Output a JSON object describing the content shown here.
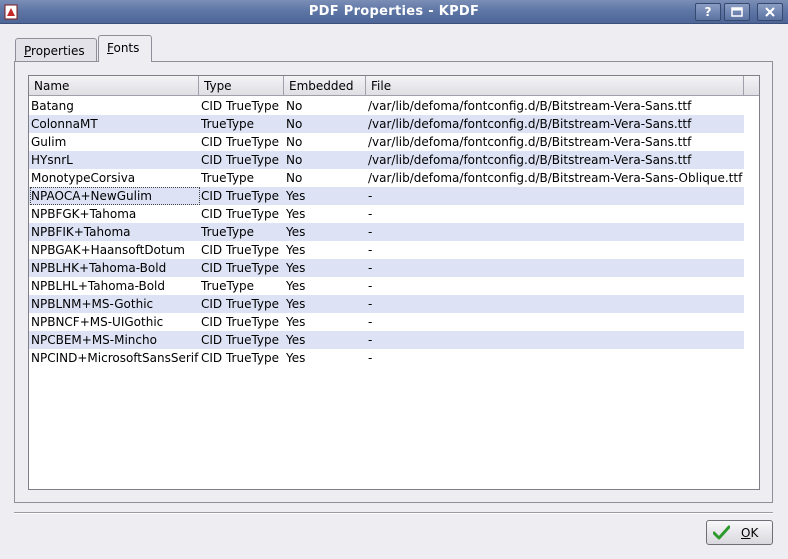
{
  "window": {
    "title": "PDF Properties - KPDF",
    "help_label": "?",
    "maximize_icon": "maximize-icon",
    "close_icon": "close-icon",
    "app_icon": "kpdf-app-icon"
  },
  "tabs": [
    {
      "mnemonic": "P",
      "rest": "roperties",
      "selected": false
    },
    {
      "mnemonic": "F",
      "rest": "onts",
      "selected": true
    }
  ],
  "fonts_table": {
    "headers": [
      "Name",
      "Type",
      "Embedded",
      "File"
    ],
    "rows": [
      {
        "name": "Batang",
        "type": "CID TrueType",
        "embedded": "No",
        "file": "/var/lib/defoma/fontconfig.d/B/Bitstream-Vera-Sans.ttf"
      },
      {
        "name": "ColonnaMT",
        "type": "TrueType",
        "embedded": "No",
        "file": "/var/lib/defoma/fontconfig.d/B/Bitstream-Vera-Sans.ttf"
      },
      {
        "name": "Gulim",
        "type": "CID TrueType",
        "embedded": "No",
        "file": "/var/lib/defoma/fontconfig.d/B/Bitstream-Vera-Sans.ttf"
      },
      {
        "name": "HYsnrL",
        "type": "CID TrueType",
        "embedded": "No",
        "file": "/var/lib/defoma/fontconfig.d/B/Bitstream-Vera-Sans.ttf"
      },
      {
        "name": "MonotypeCorsiva",
        "type": "TrueType",
        "embedded": "No",
        "file": "/var/lib/defoma/fontconfig.d/B/Bitstream-Vera-Sans-Oblique.ttf"
      },
      {
        "name": "NPAOCA+NewGulim",
        "type": "CID TrueType",
        "embedded": "Yes",
        "file": "-"
      },
      {
        "name": "NPBFGK+Tahoma",
        "type": "CID TrueType",
        "embedded": "Yes",
        "file": "-"
      },
      {
        "name": "NPBFIK+Tahoma",
        "type": "TrueType",
        "embedded": "Yes",
        "file": "-"
      },
      {
        "name": "NPBGAK+HaansoftDotum",
        "type": "CID TrueType",
        "embedded": "Yes",
        "file": "-"
      },
      {
        "name": "NPBLHK+Tahoma-Bold",
        "type": "CID TrueType",
        "embedded": "Yes",
        "file": "-"
      },
      {
        "name": "NPBLHL+Tahoma-Bold",
        "type": "TrueType",
        "embedded": "Yes",
        "file": "-"
      },
      {
        "name": "NPBLNM+MS-Gothic",
        "type": "CID TrueType",
        "embedded": "Yes",
        "file": "-"
      },
      {
        "name": "NPBNCF+MS-UIGothic",
        "type": "CID TrueType",
        "embedded": "Yes",
        "file": "-"
      },
      {
        "name": "NPCBEM+MS-Mincho",
        "type": "CID TrueType",
        "embedded": "Yes",
        "file": "-"
      },
      {
        "name": "NPCIND+MicrosoftSansSerif",
        "type": "CID TrueType",
        "embedded": "Yes",
        "file": "-"
      }
    ]
  },
  "ok_button": {
    "mnemonic": "O",
    "rest": "K",
    "icon": "checkmark-icon"
  },
  "colors": {
    "titlebar": "#5f77a6",
    "row_alt": "#dde3f5",
    "check_green": "#2e9a2e"
  }
}
